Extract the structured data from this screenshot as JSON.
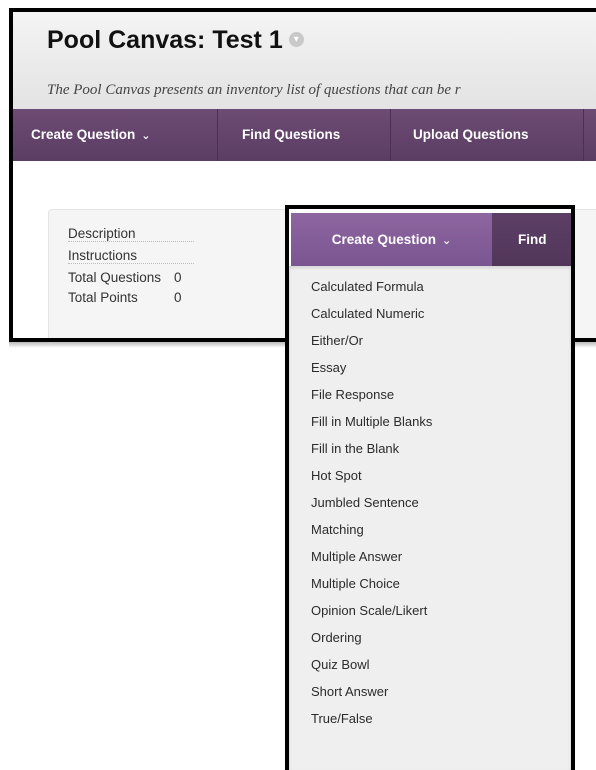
{
  "page": {
    "title": "Pool Canvas: Test 1",
    "subtitle": "The Pool Canvas presents an inventory list of questions that can be r",
    "title_icon": "chevron-down-circle-icon"
  },
  "actionbar": {
    "items": [
      {
        "label": "Create Question",
        "has_dropdown": true
      },
      {
        "label": "Find Questions"
      },
      {
        "label": "Upload Questions"
      }
    ]
  },
  "info": {
    "rows": [
      {
        "label": "Description",
        "value": ""
      },
      {
        "label": "Instructions",
        "value": ""
      },
      {
        "label": "Total Questions",
        "value": "0"
      },
      {
        "label": "Total Points",
        "value": "0"
      }
    ]
  },
  "zoom": {
    "create_label": "Create Question",
    "find_label": "Find",
    "menu": [
      "Calculated Formula",
      "Calculated Numeric",
      "Either/Or",
      "Essay",
      "File Response",
      "Fill in Multiple Blanks",
      "Fill in the Blank",
      "Hot Spot",
      "Jumbled Sentence",
      "Matching",
      "Multiple Answer",
      "Multiple Choice",
      "Opinion Scale/Likert",
      "Ordering",
      "Quiz Bowl",
      "Short Answer",
      "True/False"
    ]
  },
  "colors": {
    "actionbar": "#5b3d63",
    "active_button": "#7a5590",
    "menu_bg": "#efefef"
  }
}
